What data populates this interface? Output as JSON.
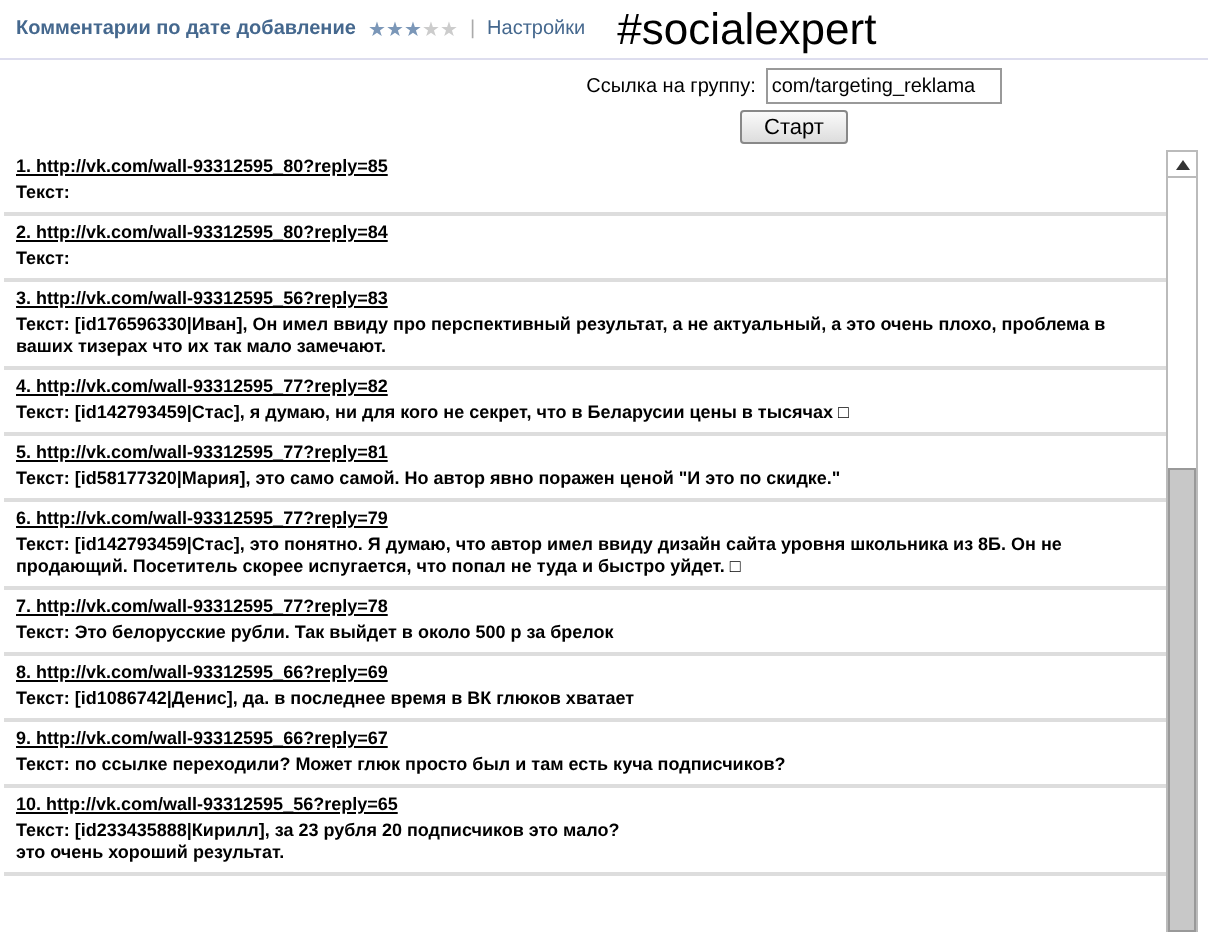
{
  "header": {
    "title": "Комментарии по дате добавление",
    "stars": 3,
    "separator": "|",
    "settings_link": "Настройки",
    "hashtag": "#socialexpert"
  },
  "form": {
    "label": "Ссылка на группу:",
    "value": "com/targeting_reklama",
    "button": "Старт"
  },
  "comments": [
    {
      "link": "1. http://vk.com/wall-93312595_80?reply=85",
      "text": "Текст:"
    },
    {
      "link": "2. http://vk.com/wall-93312595_80?reply=84",
      "text": "Текст:"
    },
    {
      "link": "3. http://vk.com/wall-93312595_56?reply=83",
      "text": "Текст: [id176596330|Иван], Он имел ввиду про перспективный результат, а не актуальный, а это очень плохо, проблема в ваших тизерах что их так мало замечают."
    },
    {
      "link": "4. http://vk.com/wall-93312595_77?reply=82",
      "text": "Текст: [id142793459|Стас], я думаю, ни для кого не секрет, что в Беларусии цены в тысячах □"
    },
    {
      "link": "5. http://vk.com/wall-93312595_77?reply=81",
      "text": "Текст: [id58177320|Мария], это само самой. Но автор явно поражен ценой \"И это по скидке.\""
    },
    {
      "link": "6. http://vk.com/wall-93312595_77?reply=79",
      "text": "Текст: [id142793459|Стас], это понятно. Я думаю, что автор имел ввиду дизайн сайта уровня школьника из 8Б. Он не продающий. Посетитель скорее испугается, что попал не туда и быстро уйдет. □"
    },
    {
      "link": "7. http://vk.com/wall-93312595_77?reply=78",
      "text": "Текст: Это белорусские рубли. Так выйдет в около 500 р за брелок"
    },
    {
      "link": "8. http://vk.com/wall-93312595_66?reply=69",
      "text": "Текст: [id1086742|Денис], да. в последнее время в ВК глюков хватает"
    },
    {
      "link": "9. http://vk.com/wall-93312595_66?reply=67",
      "text": "Текст: по ссылке переходили? Может глюк просто был и там есть куча подписчиков?"
    },
    {
      "link": "10. http://vk.com/wall-93312595_56?reply=65",
      "text": "Текст: [id233435888|Кирилл], за 23 рубля 20 подписчиков это мало?\nэто очень хороший результат."
    }
  ]
}
